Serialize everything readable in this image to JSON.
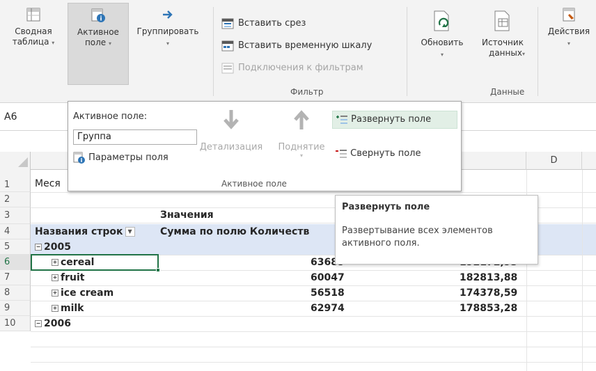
{
  "ribbon": {
    "pivot_table": {
      "line1": "Сводная",
      "line2": "таблица"
    },
    "active_field": {
      "line1": "Активное",
      "line2": "поле"
    },
    "group": {
      "line1": "Группировать"
    },
    "filter": {
      "insert_slicer": "Вставить срез",
      "insert_timeline": "Вставить временную шкалу",
      "filter_connections": "Подключения к фильтрам",
      "group_label": "Фильтр"
    },
    "refresh": {
      "line1": "Обновить"
    },
    "data_source": {
      "line1": "Источник",
      "line2": "данных"
    },
    "actions": {
      "line1": "Действия"
    },
    "data_group_label": "Данные"
  },
  "name_box": "A6",
  "columns": [
    "D"
  ],
  "active_field_panel": {
    "label": "Активное поле:",
    "field_value": "Группа",
    "field_settings": "Параметры поля",
    "drill_down": "Детализация",
    "drill_up": "Поднятие",
    "expand_field": "Развернуть поле",
    "collapse_field": "Свернуть поле",
    "group_label": "Активное поле"
  },
  "tooltip": {
    "title": "Развернуть поле",
    "body": "Развертывание всех элементов активного поля."
  },
  "rows": [
    {
      "num": "1",
      "a": "Меся"
    },
    {
      "num": "2",
      "a": ""
    },
    {
      "num": "3",
      "a": "",
      "b": "Значения"
    },
    {
      "num": "4",
      "a": "Названия строк",
      "b": "Сумма по полю Количеств"
    },
    {
      "num": "5",
      "a": "2005"
    },
    {
      "num": "6",
      "a": "cereal",
      "c": "63689",
      "d": "192172,93"
    },
    {
      "num": "7",
      "a": "fruit",
      "c": "60047",
      "d": "182813,88"
    },
    {
      "num": "8",
      "a": "ice cream",
      "c": "56518",
      "d": "174378,59"
    },
    {
      "num": "9",
      "a": "milk",
      "c": "62974",
      "d": "178853,28"
    },
    {
      "num": "10",
      "a": "2006"
    }
  ],
  "colors": {
    "accent": "#217346",
    "pivot_header": "#dde6f5",
    "highlight": "#e2efe6"
  }
}
